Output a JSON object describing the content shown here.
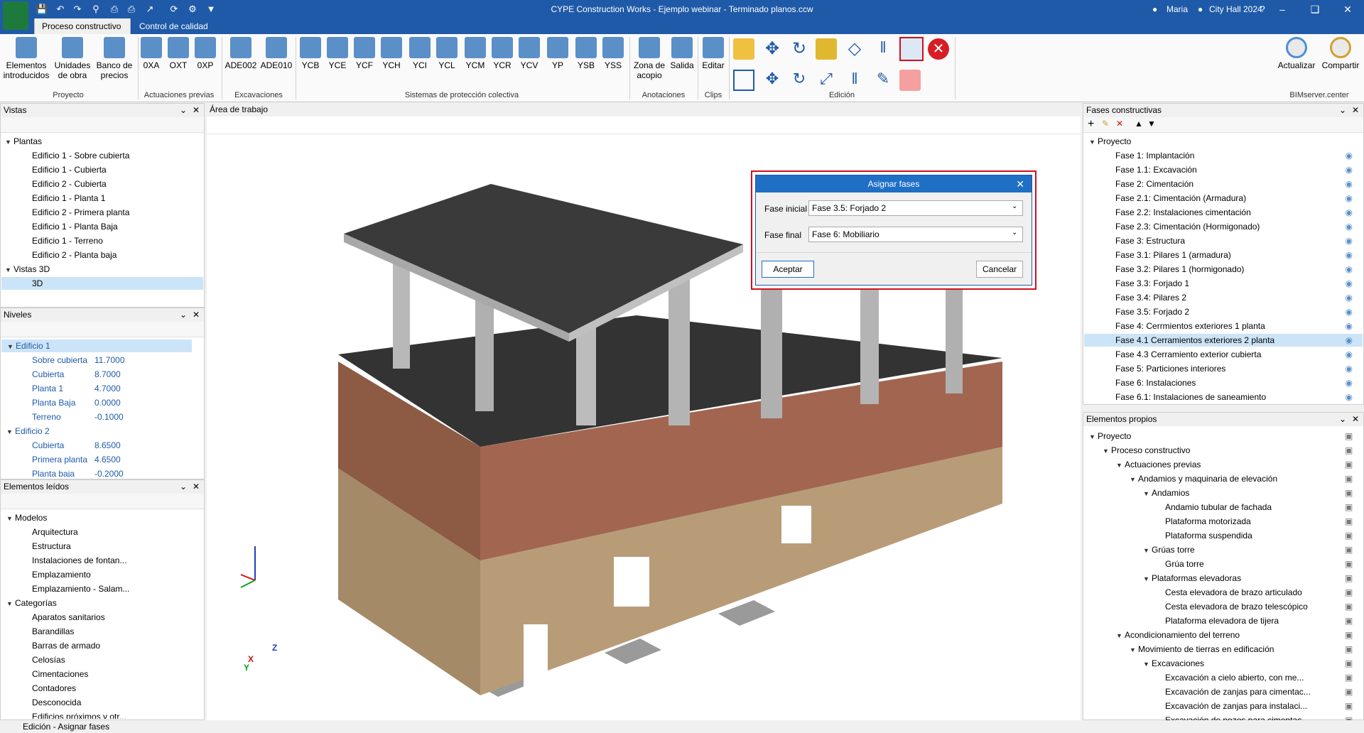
{
  "app": {
    "title": "CYPE Construction Works - Ejemplo webinar - Terminado planos.ccw",
    "user": "Maria",
    "location": "City Hall 2024"
  },
  "tabs": [
    "Proceso constructivo",
    "Control de calidad"
  ],
  "ribbon": {
    "proyecto": {
      "group": "Proyecto",
      "buttons": [
        "Elementos\nintroducidos",
        "Unidades\nde obra",
        "Banco de\nprecios"
      ]
    },
    "actuaciones": {
      "group": "Actuaciones previas",
      "buttons": [
        "0XA",
        "OXT",
        "0XP"
      ]
    },
    "excavaciones": {
      "group": "Excavaciones",
      "buttons": [
        "ADE002",
        "ADE010"
      ]
    },
    "sistemas": {
      "group": "Sistemas de protección colectiva",
      "buttons": [
        "YCB",
        "YCE",
        "YCF",
        "YCH",
        "YCI",
        "YCL",
        "YCM",
        "YCR",
        "YCV",
        "YP",
        "YSB",
        "YSS"
      ]
    },
    "anotaciones": {
      "group": "Anotaciones",
      "buttons": [
        "Zona de\nacopio",
        "Salida"
      ]
    },
    "clips": {
      "group": "Clips",
      "buttons": [
        "Editar"
      ]
    },
    "edicion": {
      "group": "Edición"
    },
    "bim": {
      "group": "BIMserver.center",
      "buttons": [
        "Actualizar",
        "Compartir"
      ]
    }
  },
  "vistas": {
    "title": "Vistas",
    "plantas_label": "Plantas",
    "plantas": [
      "Edificio 1 - Sobre cubierta",
      "Edificio 1 - Cubierta",
      "Edificio 2 - Cubierta",
      "Edificio 1 - Planta 1",
      "Edificio 2 - Primera planta",
      "Edificio 1 - Planta Baja",
      "Edificio 1 - Terreno",
      "Edificio 2 - Planta baja"
    ],
    "vistas3d_label": "Vistas 3D",
    "vistas3d": [
      "3D"
    ]
  },
  "niveles": {
    "title": "Niveles",
    "edificios": [
      {
        "name": "Edificio 1",
        "levels": [
          {
            "n": "Sobre cubierta",
            "v": "11.7000"
          },
          {
            "n": "Cubierta",
            "v": "8.7000"
          },
          {
            "n": "Planta 1",
            "v": "4.7000"
          },
          {
            "n": "Planta Baja",
            "v": "0.0000"
          },
          {
            "n": "Terreno",
            "v": "-0.1000"
          }
        ]
      },
      {
        "name": "Edificio 2",
        "levels": [
          {
            "n": "Cubierta",
            "v": "8.6500"
          },
          {
            "n": "Primera planta",
            "v": "4.6500"
          },
          {
            "n": "Planta baja",
            "v": "-0.2000"
          }
        ]
      }
    ]
  },
  "leidos": {
    "title": "Elementos leídos",
    "modelos_label": "Modelos",
    "modelos": [
      "Arquitectura",
      "Estructura",
      "Instalaciones de fontan...",
      "Emplazamiento",
      "Emplazamiento - Salam..."
    ],
    "categorias_label": "Categorías",
    "categorias": [
      "Aparatos sanitarios",
      "Barandillas",
      "Barras de armado",
      "Celosías",
      "Cimentaciones",
      "Contadores",
      "Desconocida",
      "Edificios próximos y otr..."
    ]
  },
  "workarea": {
    "title": "Área de trabajo",
    "axes": {
      "z": "Z",
      "x": "X",
      "y": "Y"
    }
  },
  "dialog": {
    "title": "Asignar fases",
    "fase_inicial_label": "Fase inicial",
    "fase_inicial": "Fase 3.5: Forjado 2",
    "fase_final_label": "Fase final",
    "fase_final": "Fase 6: Mobiliario",
    "ok": "Aceptar",
    "cancel": "Cancelar"
  },
  "fases": {
    "title": "Fases constructivas",
    "root": "Proyecto",
    "items": [
      "Fase 1: Implantación",
      "Fase 1.1: Excavación",
      "Fase 2: Cimentación",
      "Fase 2.1: Cimentación (Armadura)",
      "Fase 2.2: Instalaciones cimentación",
      "Fase 2.3: Cimentación (Hormigonado)",
      "Fase 3: Estructura",
      "Fase 3.1: Pilares 1 (armadura)",
      "Fase 3.2: Pilares 1 (hormigonado)",
      "Fase 3.3: Forjado 1",
      "Fase 3.4: Pilares 2",
      "Fase 3.5: Forjado 2",
      "Fase 4: Cerrmientos exteriores 1 planta",
      "Fase 4.1 Cerramientos exteriores 2 planta",
      "Fase 4.3 Cerramiento exterior cubierta",
      "Fase 5: Particiones interiores",
      "Fase 6: Instalaciones",
      "Fase 6.1: Instalaciones de saneamiento"
    ],
    "selected_index": 13
  },
  "propios": {
    "title": "Elementos propios",
    "tree": [
      {
        "d": 0,
        "t": "Proyecto"
      },
      {
        "d": 1,
        "t": "Proceso constructivo"
      },
      {
        "d": 2,
        "t": "Actuaciones previas"
      },
      {
        "d": 3,
        "t": "Andamios y maquinaria de elevación"
      },
      {
        "d": 4,
        "t": "Andamios"
      },
      {
        "d": 5,
        "t": "Andamio tubular de fachada"
      },
      {
        "d": 5,
        "t": "Plataforma motorizada"
      },
      {
        "d": 5,
        "t": "Plataforma suspendida"
      },
      {
        "d": 4,
        "t": "Grúas torre"
      },
      {
        "d": 5,
        "t": "Grúa torre"
      },
      {
        "d": 4,
        "t": "Plataformas elevadoras"
      },
      {
        "d": 5,
        "t": "Cesta elevadora de brazo articulado"
      },
      {
        "d": 5,
        "t": "Cesta elevadora de brazo telescópico"
      },
      {
        "d": 5,
        "t": "Plataforma elevadora de tijera"
      },
      {
        "d": 2,
        "t": "Acondicionamiento del terreno"
      },
      {
        "d": 3,
        "t": "Movimiento de tierras en edificación"
      },
      {
        "d": 4,
        "t": "Excavaciones"
      },
      {
        "d": 5,
        "t": "Excavación a cielo abierto, con me..."
      },
      {
        "d": 5,
        "t": "Excavación de zanjas para cimentac..."
      },
      {
        "d": 5,
        "t": "Excavación de zanjas para instalaci..."
      },
      {
        "d": 5,
        "t": "Excavación de pozos para cimentac..."
      }
    ]
  },
  "status": "Edición - Asignar fases"
}
